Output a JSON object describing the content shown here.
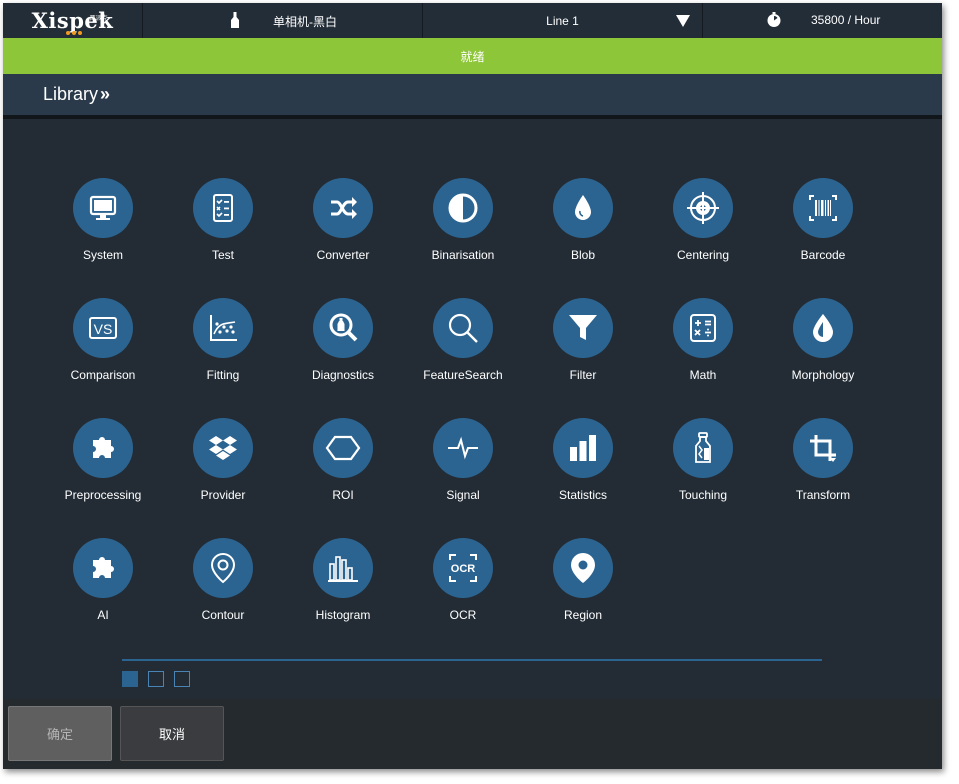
{
  "header": {
    "logo": "Xispek",
    "logo_sub": "西派克",
    "product_icon": "bottle-icon",
    "product": "单相机-黑白",
    "line": "Line 1",
    "speed_icon": "clock-icon",
    "speed": "35800 / Hour"
  },
  "status": {
    "text": "就绪",
    "color": "#8ec639"
  },
  "library": {
    "title": "Library",
    "chevron": "»"
  },
  "colors": {
    "accent": "#2c6491",
    "background": "#232c35",
    "status": "#8ec639"
  },
  "tools": [
    {
      "label": "System",
      "icon": "monitor-icon"
    },
    {
      "label": "Test",
      "icon": "checklist-icon"
    },
    {
      "label": "Converter",
      "icon": "shuffle-icon"
    },
    {
      "label": "Binarisation",
      "icon": "half-circle-icon"
    },
    {
      "label": "Blob",
      "icon": "drop-icon"
    },
    {
      "label": "Centering",
      "icon": "target-icon"
    },
    {
      "label": "Barcode",
      "icon": "barcode-icon"
    },
    {
      "label": "Comparison",
      "icon": "vs-icon"
    },
    {
      "label": "Fitting",
      "icon": "scatter-fit-icon"
    },
    {
      "label": "Diagnostics",
      "icon": "magnifier-bottle-icon"
    },
    {
      "label": "FeatureSearch",
      "icon": "search-icon"
    },
    {
      "label": "Filter",
      "icon": "funnel-icon"
    },
    {
      "label": "Math",
      "icon": "calculator-icon"
    },
    {
      "label": "Morphology",
      "icon": "morph-drop-icon"
    },
    {
      "label": "Preprocessing",
      "icon": "puzzle-icon"
    },
    {
      "label": "Provider",
      "icon": "dropbox-icon"
    },
    {
      "label": "ROI",
      "icon": "hexagon-icon"
    },
    {
      "label": "Signal",
      "icon": "pulse-icon"
    },
    {
      "label": "Statistics",
      "icon": "bar-chart-icon"
    },
    {
      "label": "Touching",
      "icon": "touching-bottle-icon"
    },
    {
      "label": "Transform",
      "icon": "crop-icon"
    },
    {
      "label": "AI",
      "icon": "puzzle-icon"
    },
    {
      "label": "Contour",
      "icon": "location-outline-icon"
    },
    {
      "label": "Histogram",
      "icon": "histogram-icon"
    },
    {
      "label": "OCR",
      "icon": "ocr-icon"
    },
    {
      "label": "Region",
      "icon": "location-pin-icon"
    }
  ],
  "pager": {
    "pages": 3,
    "current": 1
  },
  "footer": {
    "ok": "确定",
    "cancel": "取消"
  }
}
